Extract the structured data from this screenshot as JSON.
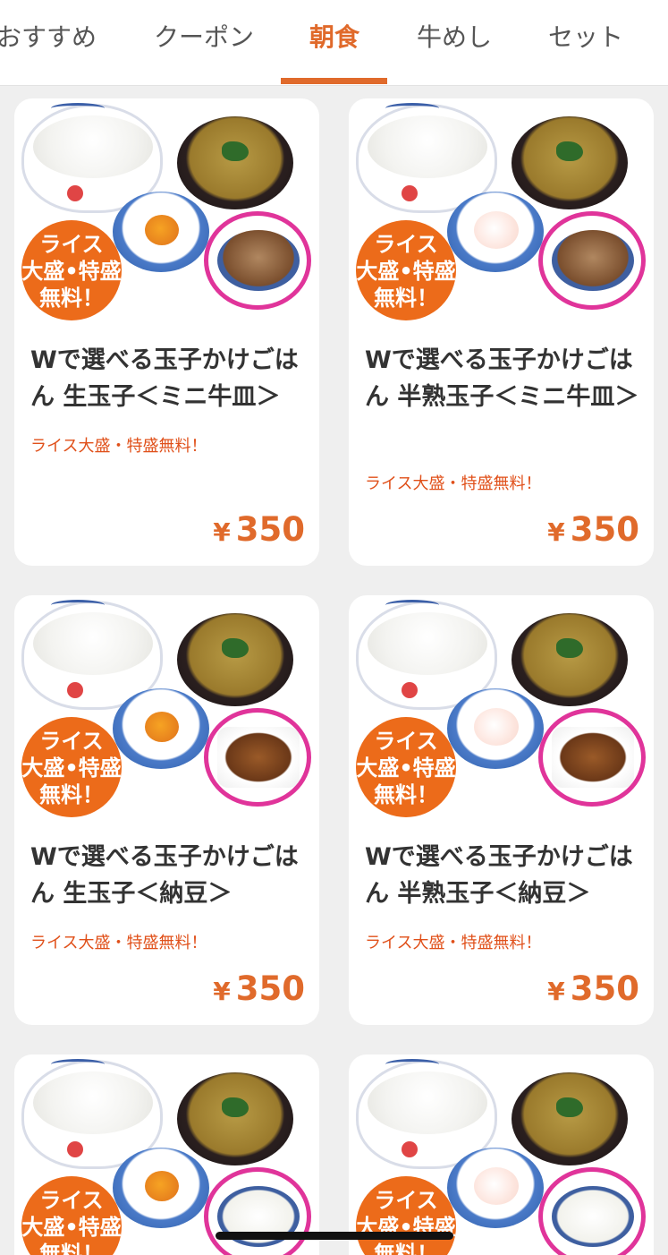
{
  "tabs": [
    {
      "label": "おすすめ",
      "active": false
    },
    {
      "label": "クーポン",
      "active": false
    },
    {
      "label": "朝食",
      "active": true
    },
    {
      "label": "牛めし",
      "active": false
    },
    {
      "label": "セット",
      "active": false
    }
  ],
  "colors": {
    "accent": "#e06a2b",
    "promo": "#e0501a",
    "badge": "#ec6b1a",
    "ring": "#e0349a"
  },
  "products": [
    {
      "title": "Wで選べる玉子かけごはん 生玉子＜ミニ牛皿＞",
      "promo": "ライス大盛・特盛無料！",
      "currency": "¥",
      "price": "350",
      "badge": [
        "ライス",
        "大盛•特盛",
        "無料！"
      ]
    },
    {
      "title": "Wで選べる玉子かけごはん 半熟玉子＜ミニ牛皿＞",
      "promo": "ライス大盛・特盛無料！",
      "currency": "¥",
      "price": "350",
      "badge": [
        "ライス",
        "大盛•特盛",
        "無料！"
      ]
    },
    {
      "title": "Wで選べる玉子かけごはん 生玉子＜納豆＞",
      "promo": "ライス大盛・特盛無料！",
      "currency": "¥",
      "price": "350",
      "badge": [
        "ライス",
        "大盛•特盛",
        "無料！"
      ]
    },
    {
      "title": "Wで選べる玉子かけごはん 半熟玉子＜納豆＞",
      "promo": "ライス大盛・特盛無料！",
      "currency": "¥",
      "price": "350",
      "badge": [
        "ライス",
        "大盛•特盛",
        "無料！"
      ]
    },
    {
      "badge": [
        "ライス",
        "大盛•特盛",
        "無料！"
      ]
    },
    {
      "badge": [
        "ライス",
        "大盛•特盛",
        "無料！"
      ]
    }
  ]
}
